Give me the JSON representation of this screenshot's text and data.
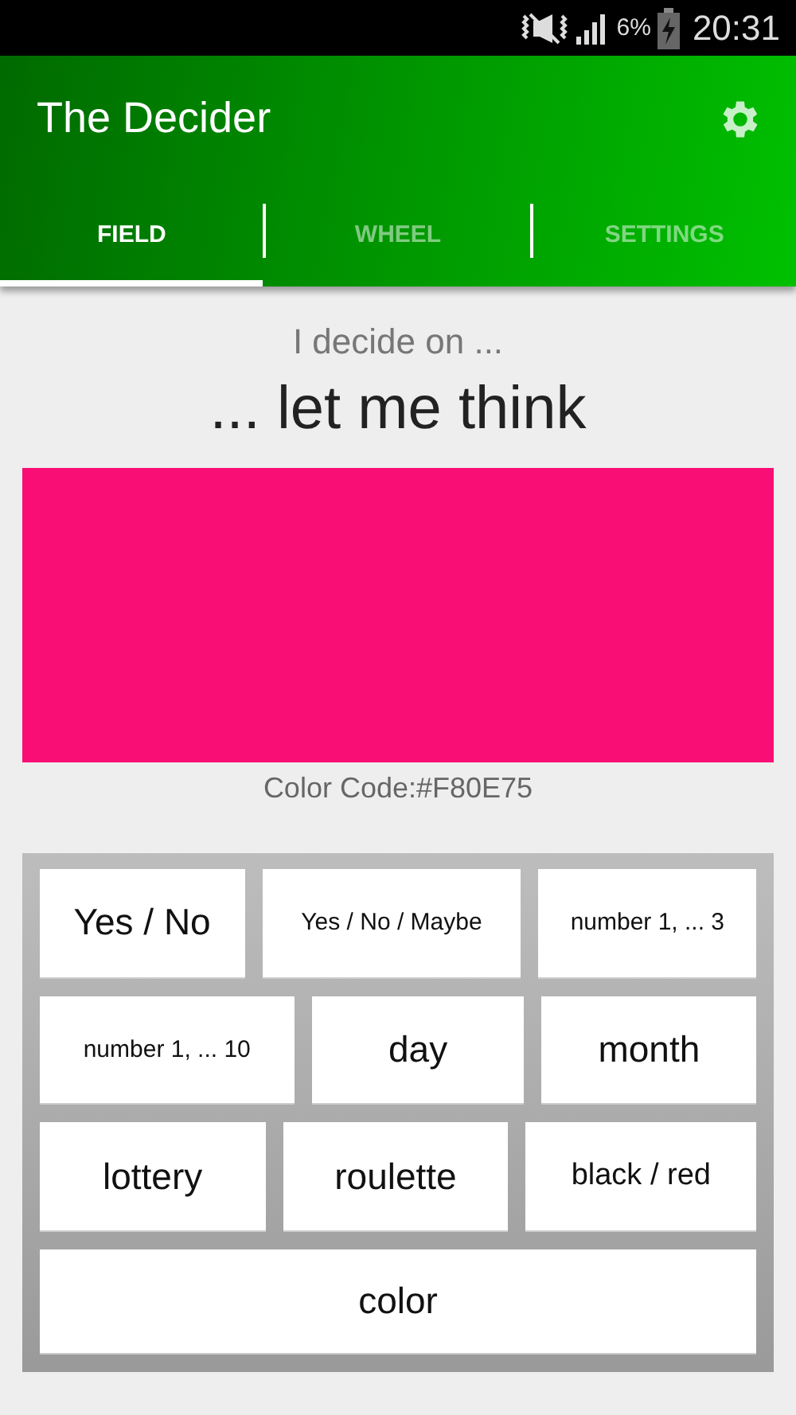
{
  "status_bar": {
    "battery_percent": "6%",
    "time": "20:31"
  },
  "app_bar": {
    "title": "The Decider"
  },
  "tabs": [
    {
      "label": "FIELD",
      "selected": true
    },
    {
      "label": "WHEEL",
      "selected": false
    },
    {
      "label": "SETTINGS",
      "selected": false
    }
  ],
  "result": {
    "heading": "I decide on ...",
    "answer": "... let me think",
    "swatch": {
      "color": "#f80e75"
    },
    "color_code": "Color Code:#F80E75"
  },
  "choices": [
    [
      {
        "label": "Yes / No",
        "kind": "large"
      },
      {
        "label": "Yes / No / Maybe",
        "kind": "small"
      },
      {
        "label": "number 1, ... 3",
        "kind": "small"
      }
    ],
    [
      {
        "label": "number 1, ... 10",
        "kind": "small"
      },
      {
        "label": "day",
        "kind": "large"
      },
      {
        "label": "month",
        "kind": "large"
      }
    ],
    [
      {
        "label": "lottery",
        "kind": "large"
      },
      {
        "label": "roulette",
        "kind": "large"
      },
      {
        "label": "black / red",
        "kind": "medium"
      }
    ],
    [
      {
        "label": "color",
        "kind": "large"
      }
    ]
  ]
}
